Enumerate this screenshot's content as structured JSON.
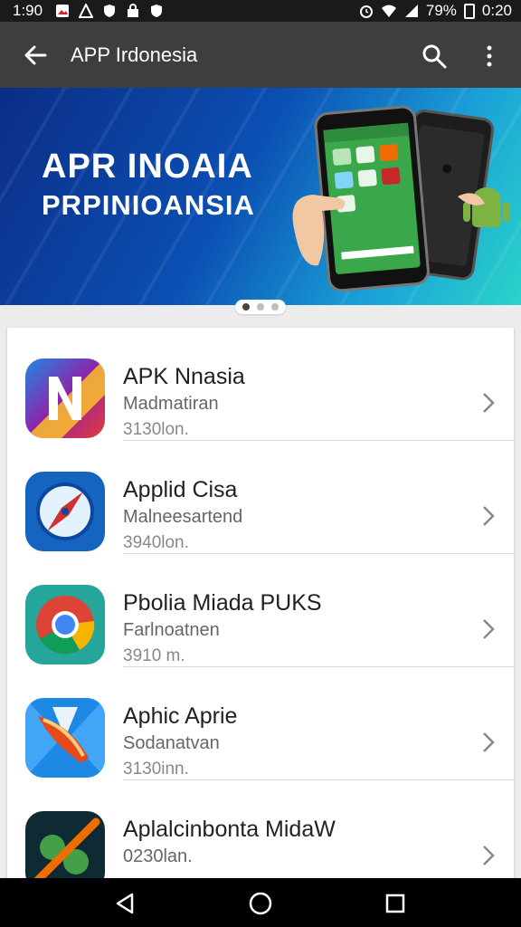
{
  "status_bar": {
    "time": "1:90",
    "battery": "79%",
    "clock": "0:20",
    "icons": [
      "photo-icon",
      "warning-icon",
      "shield-icon",
      "lock-icon",
      "shield-icon",
      "alarm-icon",
      "wifi-icon",
      "signal-icon",
      "battery-icon"
    ]
  },
  "app_bar": {
    "title": "APP Irdonesia",
    "back_icon": "arrow-left-icon",
    "search_icon": "search-icon",
    "menu_icon": "more-vert-icon"
  },
  "banner": {
    "line1": "APR INOAIA",
    "line2": "PRPINIOANSIA",
    "pages": 3,
    "active_page": 1
  },
  "apps": [
    {
      "name": "APK Nnasia",
      "category": "Madmatiran",
      "size": "3130lon.",
      "icon": "gradient-n-icon"
    },
    {
      "name": "Applid Cisa",
      "category": "Malneesartend",
      "size": "3940lon.",
      "icon": "compass-icon"
    },
    {
      "name": "Pbolia Miada PUKS",
      "category": "Farlnoatnen",
      "size": "3910 m.",
      "icon": "chrome-icon"
    },
    {
      "name": "Aphic Aprie",
      "category": "Sodanatvan",
      "size": "3130inn.",
      "icon": "rocket-icon"
    },
    {
      "name": "Aplalcinbonta MidaW",
      "category": "0230lan.",
      "size": "",
      "icon": "sd-icon"
    }
  ],
  "nav_bar": {
    "icons": [
      "back-triangle-icon",
      "home-circle-icon",
      "recents-square-icon"
    ]
  }
}
